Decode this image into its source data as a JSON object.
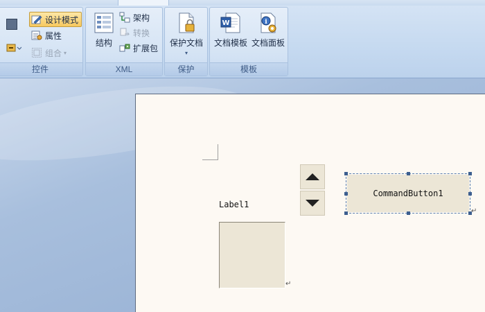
{
  "ribbon": {
    "controls_group": {
      "label": "控件",
      "design_mode": "设计模式",
      "properties": "属性",
      "group_cmd": "组合"
    },
    "xml_group": {
      "label": "XML",
      "structure": "结构",
      "schema": "架构",
      "transform": "转换",
      "expansion_pack": "扩展包"
    },
    "protect_group": {
      "label": "保护",
      "protect_document": "保护文档"
    },
    "templates_group": {
      "label": "模板",
      "document_template": "文档模板",
      "document_panel": "文档面板"
    }
  },
  "document": {
    "label_text": "Label1",
    "command_button_text": "CommandButton1",
    "paragraph_mark": "↵"
  },
  "colors": {
    "accent": "#3d5f8f",
    "control_face": "#ece6d6",
    "page_background": "#fdf9f3",
    "ribbon": "#d4e3f4"
  }
}
